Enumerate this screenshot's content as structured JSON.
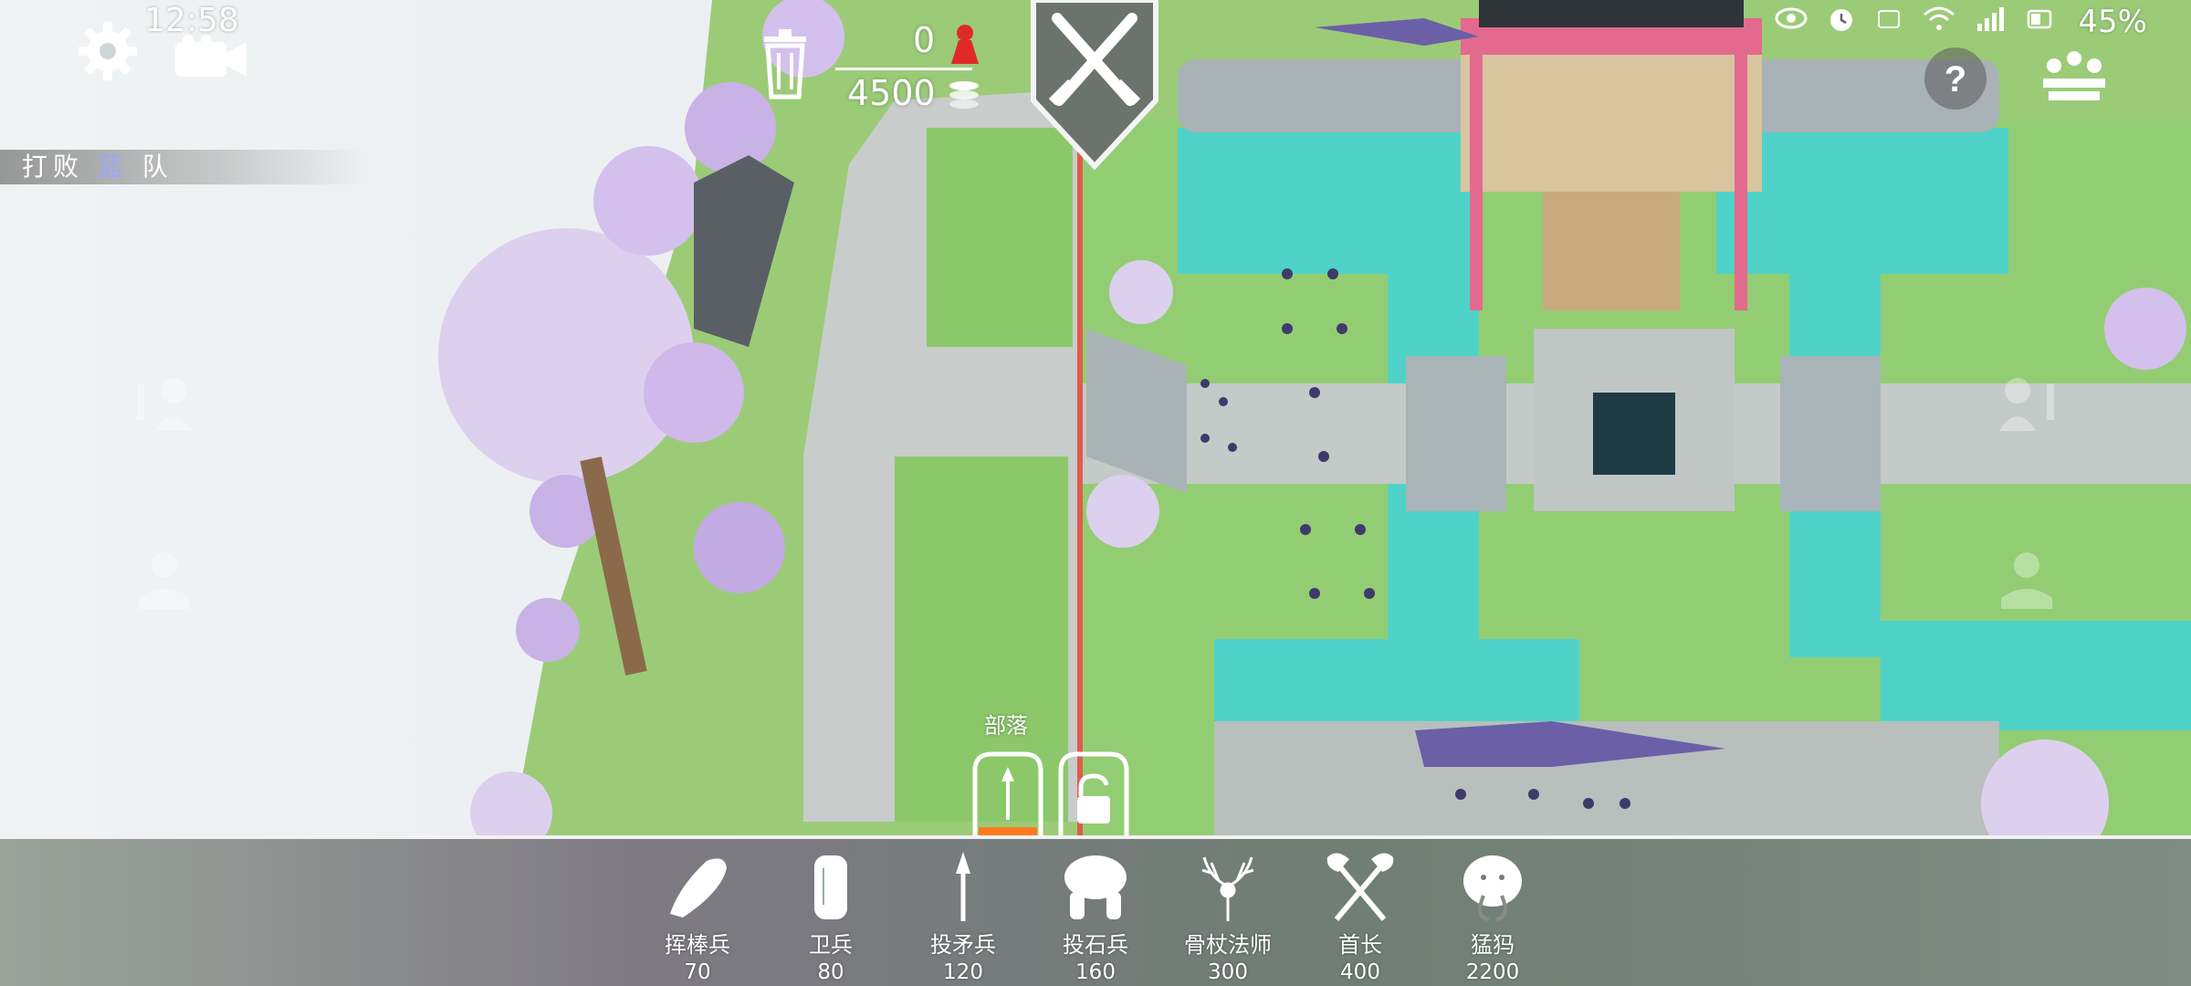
{
  "status_bar": {
    "time": "12:58",
    "battery": "45%",
    "icons": [
      "eye-icon",
      "alarm-icon",
      "network-speed-icon",
      "wifi-icon",
      "signal-icon",
      "battery-icon"
    ]
  },
  "objective": {
    "prefix": "打败",
    "team": "蓝",
    "suffix": "队"
  },
  "counters": {
    "units_placed": "0",
    "budget": "4500"
  },
  "top_icons": [
    "gear-icon",
    "camera-icon",
    "trash-icon",
    "red-pawn-icon",
    "crossed-swords-icon",
    "help-icon",
    "crown-icon"
  ],
  "faction": {
    "label": "部落"
  },
  "units": [
    {
      "name": "挥棒兵",
      "cost": "70",
      "icon": "club-icon"
    },
    {
      "name": "卫兵",
      "cost": "80",
      "icon": "shield-icon"
    },
    {
      "name": "投矛兵",
      "cost": "120",
      "icon": "spear-icon"
    },
    {
      "name": "投石兵",
      "cost": "160",
      "icon": "stone-thrower-icon"
    },
    {
      "name": "骨杖法师",
      "cost": "300",
      "icon": "antler-staff-icon"
    },
    {
      "name": "首长",
      "cost": "400",
      "icon": "crossed-axes-icon"
    },
    {
      "name": "猛犸",
      "cost": "2200",
      "icon": "mammoth-icon"
    }
  ],
  "colors": {
    "grass": "#8cc86a",
    "water": "#4fd3c8",
    "path": "#c7ccca",
    "blossom": "#d9c6ec",
    "shrine": "#e36a8e",
    "divider": "#e05a4a",
    "bar": "#7d8a80"
  }
}
